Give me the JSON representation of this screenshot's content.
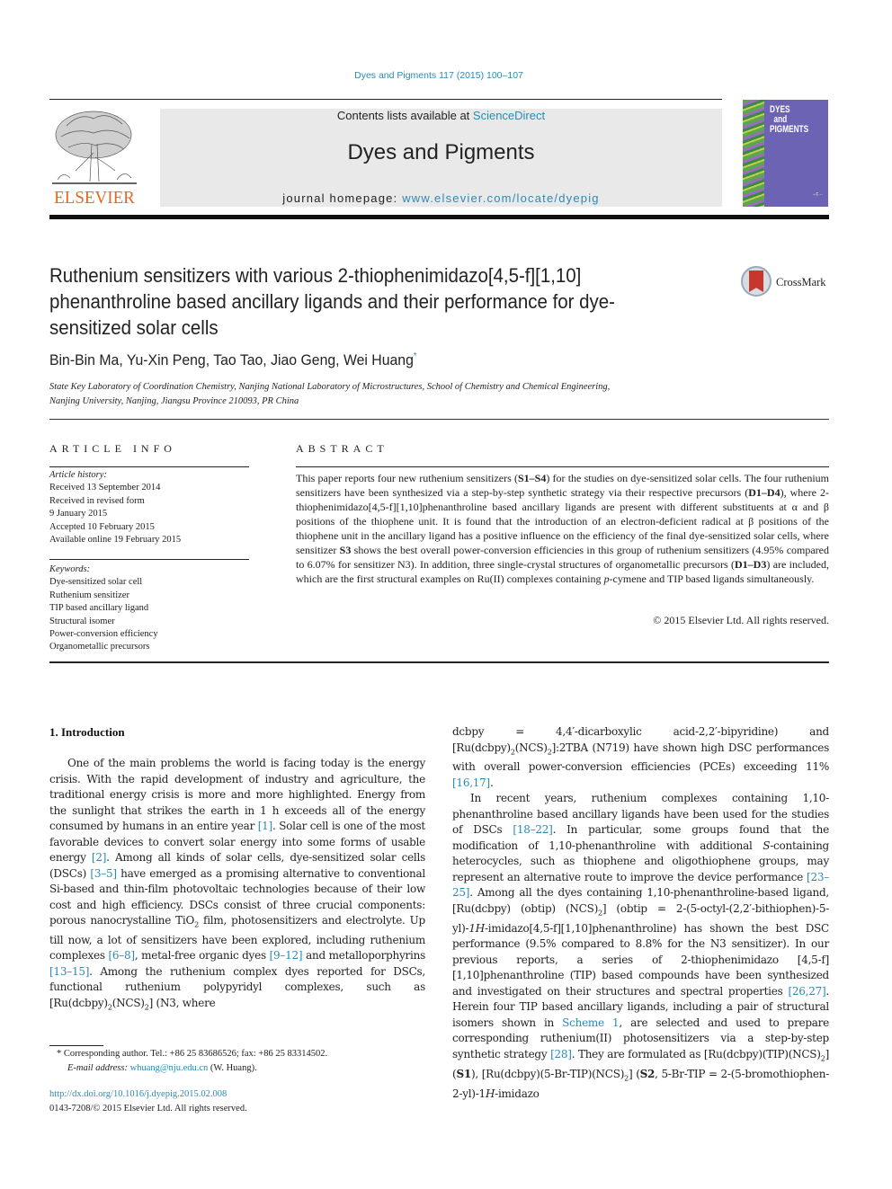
{
  "journal_citation": "Dyes and Pigments 117 (2015) 100–107",
  "header": {
    "publisher_logo_text": "ELSEVIER",
    "contents_prefix": "Contents lists available at ",
    "contents_link": "ScienceDirect",
    "journal_name": "Dyes and Pigments",
    "homepage_prefix": "journal homepage: ",
    "homepage_link": "www.elsevier.com/locate/dyepig",
    "cover_title_1": "DYES",
    "cover_title_2": "and",
    "cover_title_3": "PIGMENTS"
  },
  "article": {
    "title": "Ruthenium sensitizers with various 2-thiophenimidazo[4,5-f][1,10] phenanthroline based ancillary ligands and their performance for dye-sensitized solar cells",
    "crossmark_label": "CrossMark",
    "authors": "Bin-Bin Ma, Yu-Xin Peng, Tao Tao, Jiao Geng, Wei Huang",
    "author_marker": "*",
    "affiliation_line1": "State Key Laboratory of Coordination Chemistry, Nanjing National Laboratory of Microstructures, School of Chemistry and Chemical Engineering,",
    "affiliation_line2": "Nanjing University, Nanjing, Jiangsu Province 210093, PR China"
  },
  "article_info": {
    "heading": "ARTICLE INFO",
    "history_label": "Article history:",
    "history": [
      "Received 13 September 2014",
      "Received in revised form",
      "9 January 2015",
      "Accepted 10 February 2015",
      "Available online 19 February 2015"
    ],
    "keywords_label": "Keywords:",
    "keywords": [
      "Dye-sensitized solar cell",
      "Ruthenium sensitizer",
      "TIP based ancillary ligand",
      "Structural isomer",
      "Power-conversion efficiency",
      "Organometallic precursors"
    ]
  },
  "abstract": {
    "heading": "ABSTRACT",
    "t1": "This paper reports four new ruthenium sensitizers (",
    "b1": "S1–S4",
    "t2": ") for the studies on dye-sensitized solar cells. The four ruthenium sensitizers have been synthesized via a step-by-step synthetic strategy via their respective precursors (",
    "b2": "D1–D4",
    "t3": "), where 2-thiophenimidazo[4,5-f][1,10]phenanthroline based ancillary ligands are present with different substituents at α and β positions of the thiophene unit. It is found that the introduction of an electron-deficient radical at β positions of the thiophene unit in the ancillary ligand has a positive influence on the efficiency of the final dye-sensitized solar cells, where sensitizer ",
    "b3": "S3",
    "t4": " shows the best overall power-conversion efficiencies in this group of ruthenium sensitizers (4.95% compared to 6.07% for sensitizer N3). In addition, three single-crystal structures of organometallic precursors (",
    "b4": "D1–D3",
    "t5": ") are included, which are the first structural examples on Ru(II) complexes containing ",
    "i5": "p",
    "t6": "-cymene and TIP based ligands simultaneously.",
    "copyright": "© 2015 Elsevier Ltd. All rights reserved."
  },
  "intro": {
    "heading": "1.  Introduction",
    "left": {
      "a1": "One of the main problems the world is facing today is the energy crisis. With the rapid development of industry and agriculture, the traditional energy crisis is more and more highlighted. Energy from the sunlight that strikes the earth in 1 h exceeds all of the energy consumed by humans in an entire year ",
      "c1": "[1]",
      "a2": ". Solar cell is one of the most favorable devices to convert solar energy into some forms of usable energy ",
      "c2": "[2]",
      "a3": ". Among all kinds of solar cells, dye-sensitized solar cells (DSCs) ",
      "c3": "[3–5]",
      "a4": " have emerged as a promising alternative to conventional Si-based and thin-film photovoltaic technologies because of their low cost and high efficiency. DSCs consist of three crucial components: porous nanocrystalline TiO",
      "s4": "2",
      "a5": " film, photosensitizers and electrolyte. Up till now, a lot of sensitizers have been explored, including ruthenium complexes ",
      "c5": "[6–8]",
      "a6": ", metal-free organic dyes ",
      "c6": "[9–12]",
      "a7": " and metalloporphyrins ",
      "c7": "[13–15]",
      "a8": ". Among the ruthenium complex dyes reported for DSCs, functional ruthenium polypyridyl complexes, such as [Ru(dcbpy)",
      "s8": "2",
      "a9": "(NCS)",
      "s9": "2",
      "a10": "] (N3, where"
    },
    "right": {
      "p1a": "dcbpy = 4,4′-dicarboxylic acid-2,2′-bipyridine) and [Ru(dcbpy)",
      "p1s1": "2",
      "p1b": "(NCS)",
      "p1s2": "2",
      "p1c": "]:2TBA (N719) have shown high DSC performances with overall power-conversion efficiencies (PCEs) exceeding 11% ",
      "p1cite": "[16,17]",
      "p1d": ".",
      "p2a": "In recent years, ruthenium complexes containing 1,10-phenanthroline based ancillary ligands have been used for the studies of DSCs ",
      "p2c1": "[18–22]",
      "p2b": ". In particular, some groups found that the modification of 1,10-phenanthroline with additional ",
      "p2i1": "S",
      "p2c": "-containing heterocycles, such as thiophene and oligothiophene groups, may represent an alternative route to improve the device performance ",
      "p2c2": "[23–25]",
      "p2d": ". Among all the dyes containing 1,10-phenanthroline-based ligand, [Ru(dcbpy) (obtip) (NCS)",
      "p2s1": "2",
      "p2e": "] (obtip = 2-(5-octyl-(2,2′-bithiophen)-5-yl)-",
      "p2i2": "1H",
      "p2f": "-imidazo[4,5-f][1,10]phenanthroline) has shown the best DSC performance (9.5% compared to 8.8% for the N3 sensitizer). In our previous reports, a series of 2-thiophenimidazo [4,5-f][1,10]phenanthroline (TIP) based compounds have been synthesized and investigated on their structures and spectral properties ",
      "p2c3": "[26,27]",
      "p2g": ". Herein four TIP based ancillary ligands, including a pair of structural isomers shown in ",
      "p2c4": "Scheme 1",
      "p2h": ", are selected and used to prepare corresponding ruthenium(II) photosensitizers via a step-by-step synthetic strategy ",
      "p2c5": "[28]",
      "p2i": ". They are formulated as [Ru(dcbpy)(TIP)(NCS)",
      "p2s2": "2",
      "p2j": "] (",
      "p2b1": "S1",
      "p2k": "), [Ru(dcbpy)(5-Br-TIP)(NCS)",
      "p2s3": "2",
      "p2l": "] (",
      "p2b2": "S2",
      "p2m": ", 5-Br-TIP = 2-(5-bromothiophen-2-yl)-1",
      "p2i3": "H",
      "p2n": "-imidazo"
    }
  },
  "footnote": {
    "marker": "*",
    "corresponding": " Corresponding author. Tel.: +86 25 83686526; fax: +86 25 83314502.",
    "email_label": "E-mail address: ",
    "email": "whuang@nju.edu.cn",
    "email_suffix": " (W. Huang)."
  },
  "doi": "http://dx.doi.org/10.1016/j.dyepig.2015.02.008",
  "issn_copyright": "0143-7208/© 2015 Elsevier Ltd. All rights reserved."
}
